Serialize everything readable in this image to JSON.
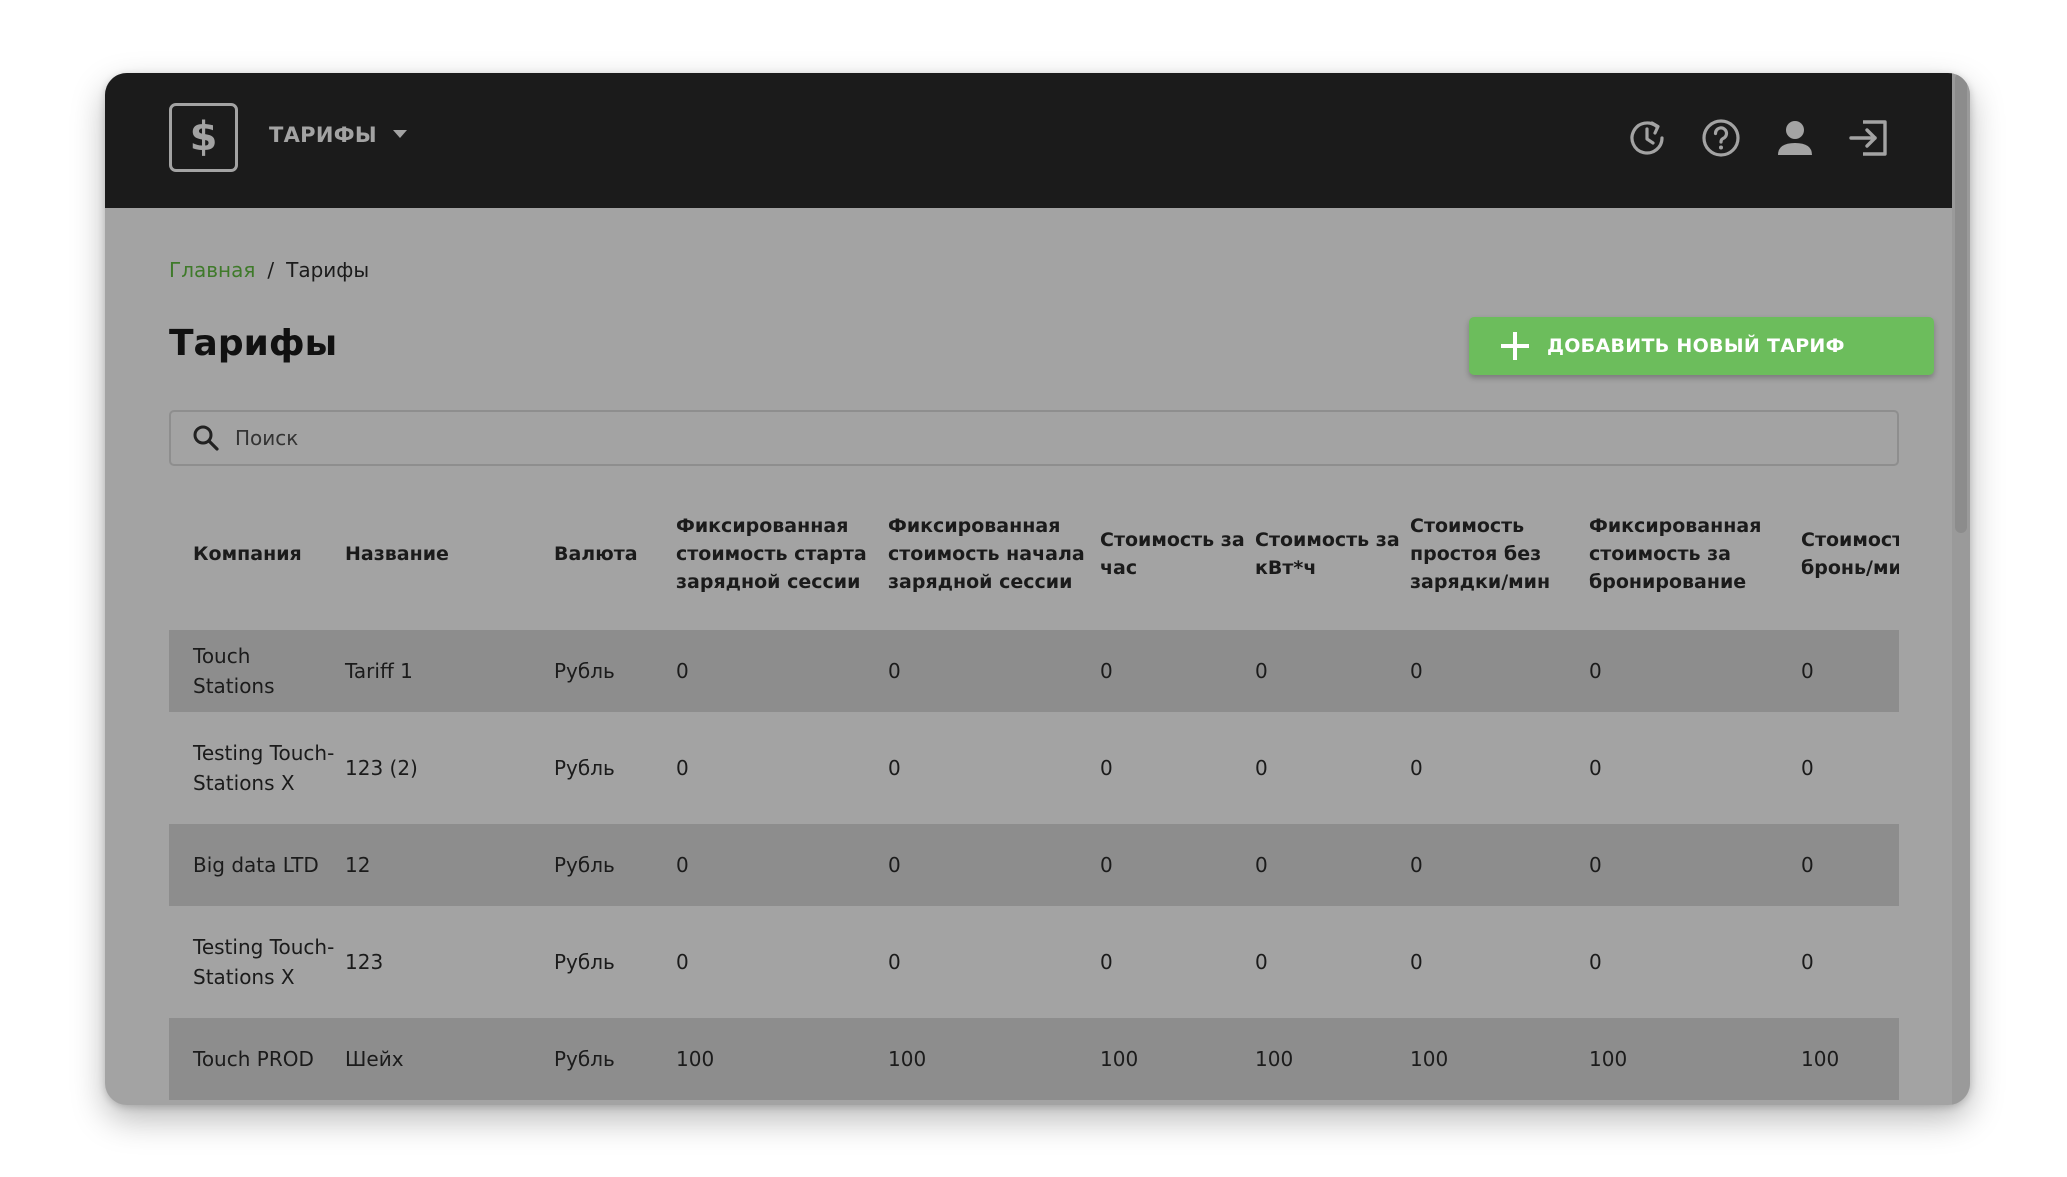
{
  "header": {
    "logo_symbol": "$",
    "app_title": "ТАРИФЫ",
    "icons": [
      "history-icon",
      "help-icon",
      "user-icon",
      "logout-icon"
    ]
  },
  "breadcrumb": {
    "home": "Главная",
    "separator": "/",
    "current": "Тарифы"
  },
  "page": {
    "title": "Тарифы",
    "add_button_label": "ДОБАВИТЬ НОВЫЙ ТАРИФ"
  },
  "search": {
    "placeholder": "Поиск",
    "value": ""
  },
  "table": {
    "columns": [
      "Компания",
      "Название",
      "Валюта",
      "Фиксированная стоимость старта зарядной сессии",
      "Фиксированная стоимость начала зарядной сессии",
      "Стоимость за час",
      "Стоимость за кВт*ч",
      "Стоимость простоя без зарядки/мин",
      "Фиксированная стоимость за бронирование",
      "Стоимость за бронь/мин"
    ],
    "rows": [
      {
        "company": "Touch Stations",
        "name": "Tariff 1",
        "currency": "Рубль",
        "c4": "0",
        "c5": "0",
        "c6": "0",
        "c7": "0",
        "c8": "0",
        "c9": "0",
        "c10": "0"
      },
      {
        "company": "Testing Touch-Stations X",
        "name": "123 (2)",
        "currency": "Рубль",
        "c4": "0",
        "c5": "0",
        "c6": "0",
        "c7": "0",
        "c8": "0",
        "c9": "0",
        "c10": "0"
      },
      {
        "company": "Big data LTD",
        "name": "12",
        "currency": "Рубль",
        "c4": "0",
        "c5": "0",
        "c6": "0",
        "c7": "0",
        "c8": "0",
        "c9": "0",
        "c10": "0"
      },
      {
        "company": "Testing Touch-Stations X",
        "name": "123",
        "currency": "Рубль",
        "c4": "0",
        "c5": "0",
        "c6": "0",
        "c7": "0",
        "c8": "0",
        "c9": "0",
        "c10": "0"
      },
      {
        "company": "Touch PROD",
        "name": "Шейх",
        "currency": "Рубль",
        "c4": "100",
        "c5": "100",
        "c6": "100",
        "c7": "100",
        "c8": "100",
        "c9": "100",
        "c10": "100"
      }
    ]
  },
  "colors": {
    "topbar": "#1b1b1b",
    "overlay_bg": "#a3a3a3",
    "row_striped": "#8d8d8d",
    "accent_green": "#6cbd5c",
    "link_green": "#3f7a2a"
  }
}
